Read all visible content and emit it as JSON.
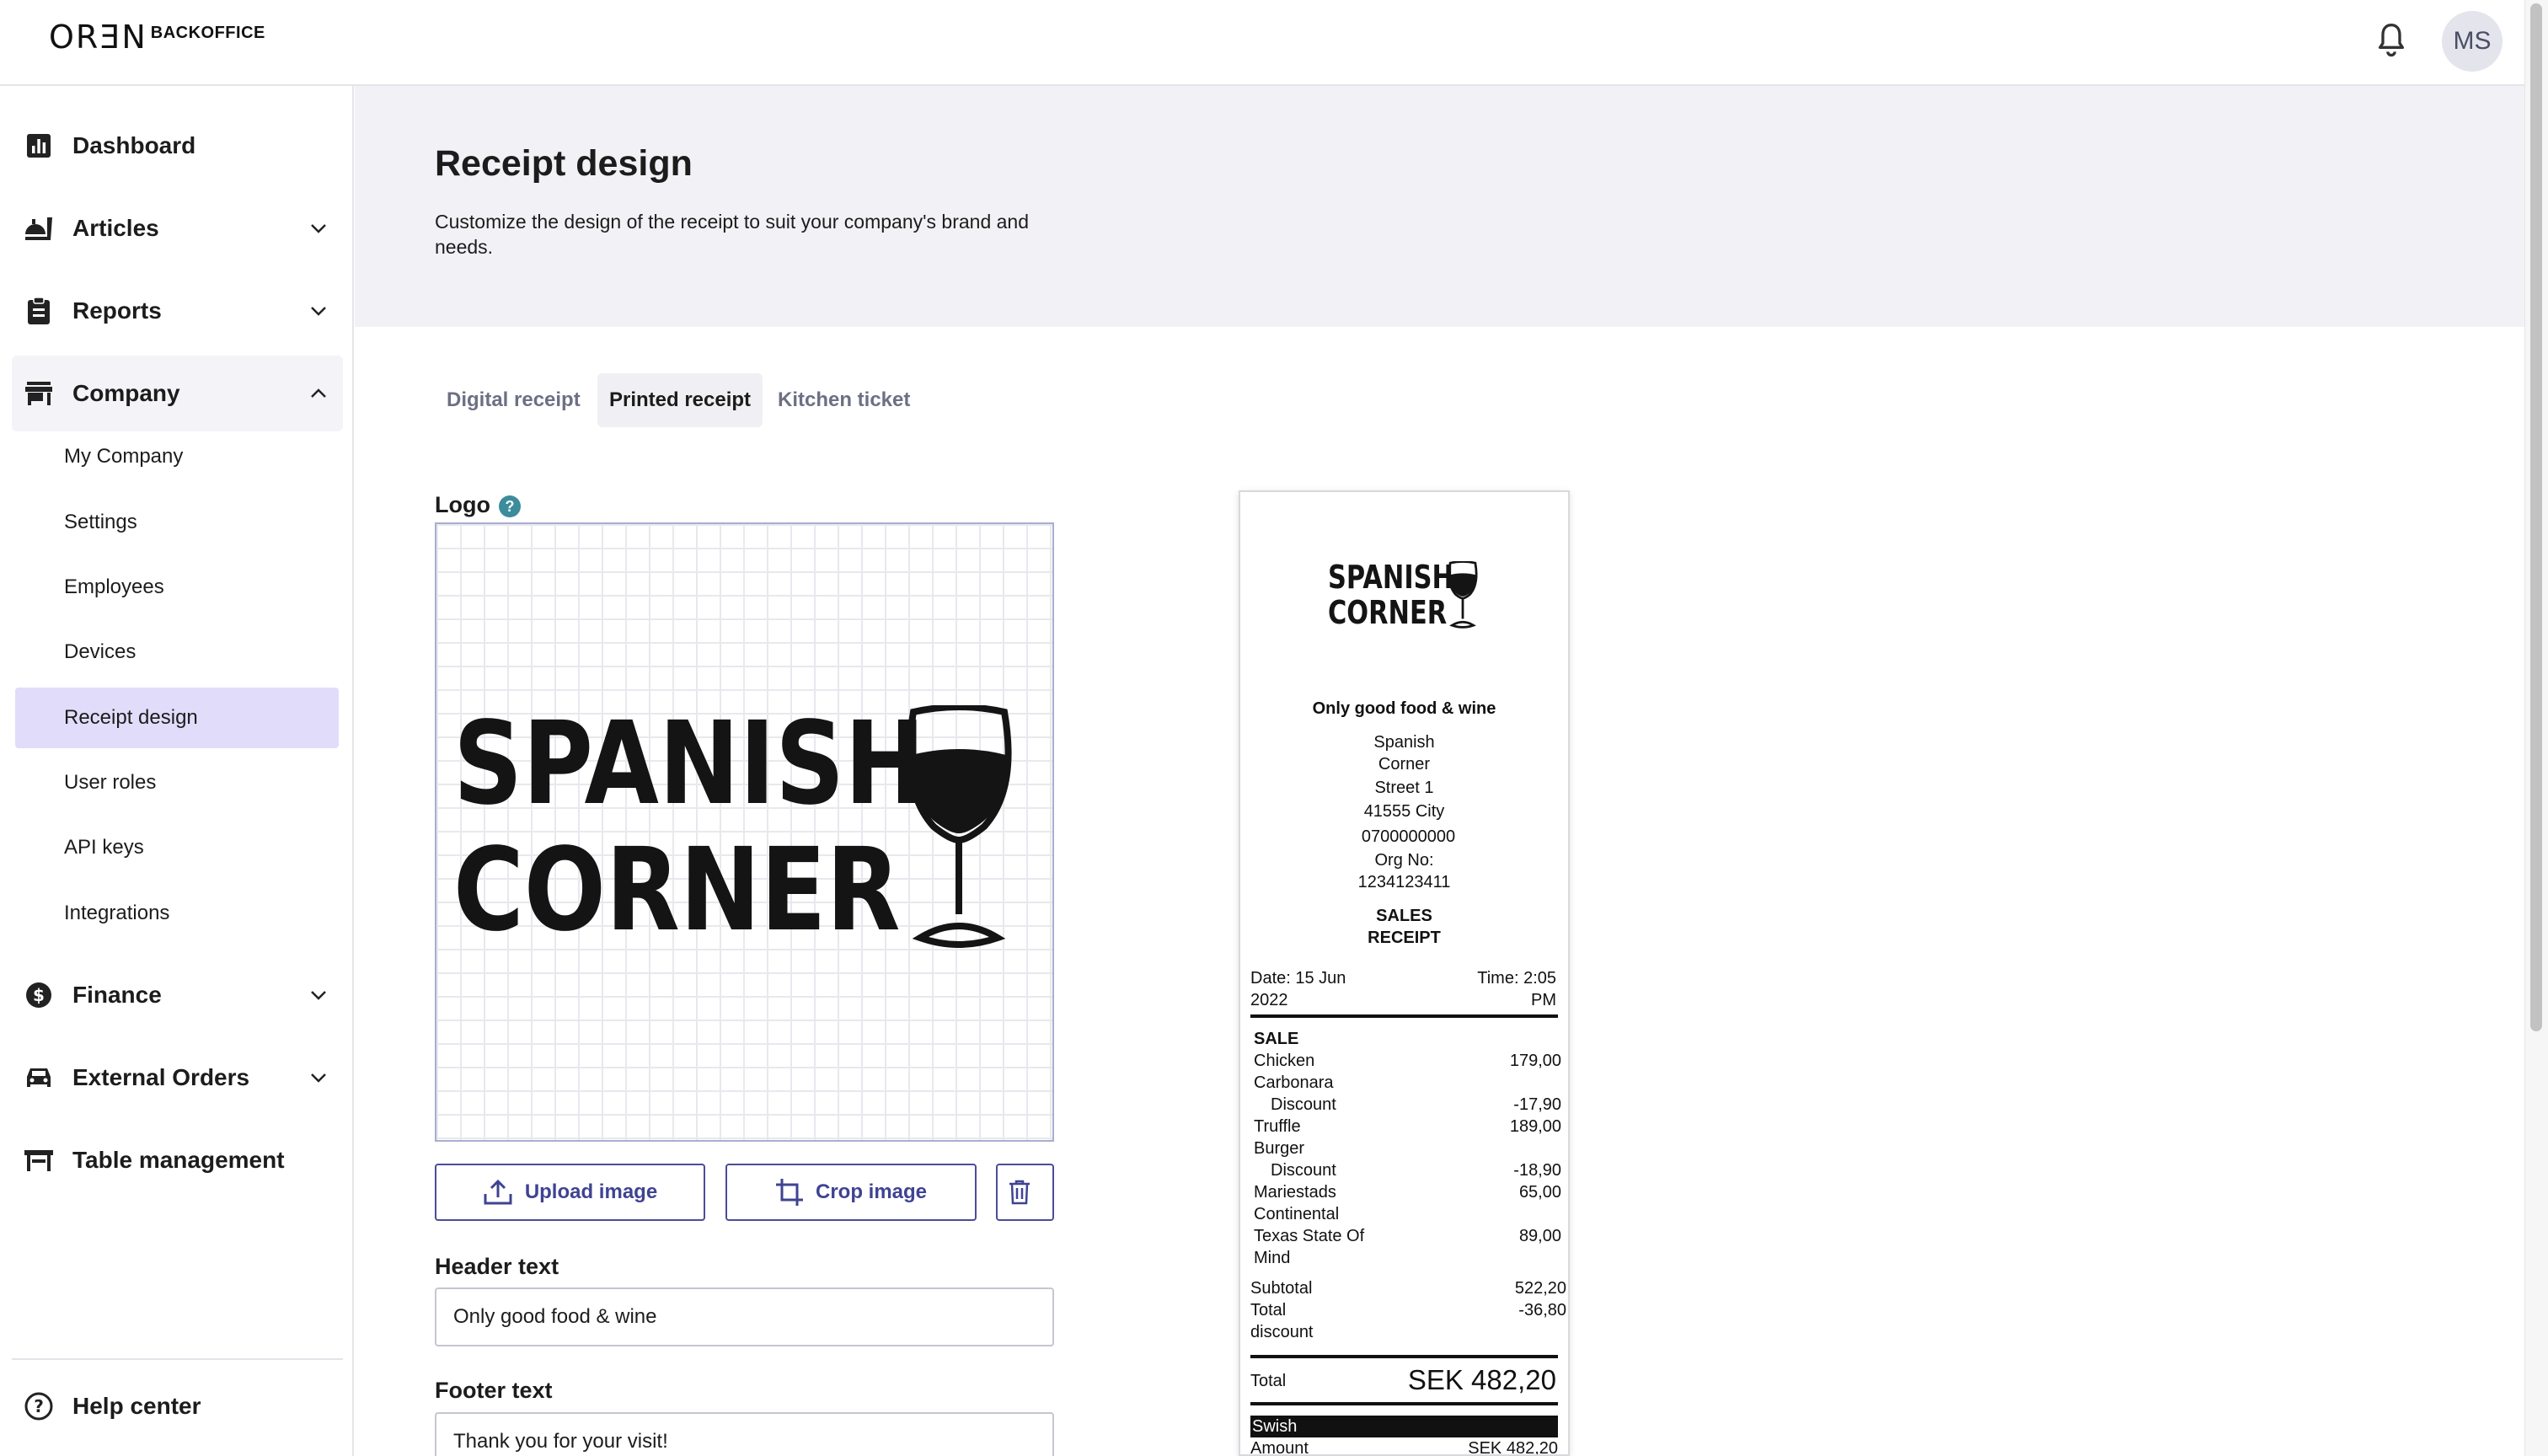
{
  "app": {
    "logo_mark": "ORƎN",
    "logo_text": "BACKOFFICE",
    "user_initials": "MS"
  },
  "sidebar": {
    "dashboard": "Dashboard",
    "articles": "Articles",
    "reports": "Reports",
    "company": "Company",
    "company_items": [
      "My Company",
      "Settings",
      "Employees",
      "Devices",
      "Receipt design",
      "User roles",
      "API keys",
      "Integrations"
    ],
    "active_item": "Receipt design",
    "finance": "Finance",
    "external_orders": "External Orders",
    "table_management": "Table management",
    "help_center": "Help center"
  },
  "page": {
    "title": "Receipt design",
    "description": "Customize the design of the receipt to suit your company's brand and needs."
  },
  "tabs": [
    "Digital receipt",
    "Printed receipt",
    "Kitchen ticket"
  ],
  "active_tab": "Printed receipt",
  "form": {
    "logo_label": "Logo",
    "help_symbol": "?",
    "upload_label": "Upload image",
    "crop_label": "Crop image",
    "header_label": "Header text",
    "header_value": "Only good food & wine",
    "footer_label": "Footer text",
    "footer_value": "Thank you for your visit!"
  },
  "brand": {
    "line1": "SPANISH",
    "line2": "CORNER"
  },
  "receipt": {
    "header": "Only good food & wine",
    "address": [
      "Spanish",
      "Corner",
      "Street 1",
      "41555 City",
      "0700000000",
      "Org No:",
      "1234123411"
    ],
    "type": [
      "SALES",
      "RECEIPT"
    ],
    "date": [
      "Date: 15 Jun",
      "2022"
    ],
    "time": [
      "Time: 2:05",
      "PM"
    ],
    "section": "SALE",
    "items": [
      {
        "name": [
          "Chicken",
          "Carbonara"
        ],
        "price": "179,00",
        "discount": "-17,90"
      },
      {
        "name": [
          "Truffle",
          "Burger"
        ],
        "price": "189,00",
        "discount": "-18,90"
      },
      {
        "name": [
          "Mariestads",
          "Continental"
        ],
        "price": "65,00"
      },
      {
        "name": [
          "Texas State Of",
          "Mind"
        ],
        "price": "89,00"
      }
    ],
    "discount_label": "Discount",
    "subtotal_label": "Subtotal",
    "subtotal": "522,20",
    "total_discount_label": [
      "Total",
      "discount"
    ],
    "total_discount": "-36,80",
    "total_label": "Total",
    "total": "SEK 482,20",
    "payment": "Swish",
    "amount_label": "Amount",
    "amount": "SEK 482,20"
  }
}
